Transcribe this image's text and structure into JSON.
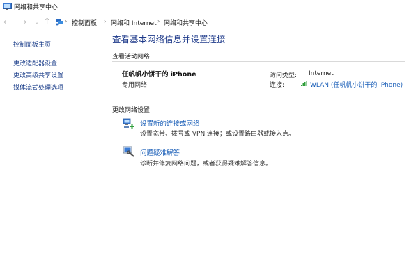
{
  "window": {
    "title": "网络和共享中心"
  },
  "nav": {
    "back_icon": "arrow-left-icon",
    "forward_icon": "arrow-right-icon",
    "history_icon": "chevron-down-icon",
    "up_icon": "arrow-up-icon"
  },
  "breadcrumb": [
    "控制面板",
    "网络和 Internet",
    "网络和共享中心"
  ],
  "sidebar": {
    "items": [
      {
        "label": "控制面板主页"
      },
      {
        "label": "更改适配器设置"
      },
      {
        "label": "更改高级共享设置"
      },
      {
        "label": "媒体流式处理选项"
      }
    ]
  },
  "main": {
    "title": "查看基本网络信息并设置连接",
    "active_section": "查看活动网络",
    "network": {
      "name": "任帆帆小饼干的 iPhone",
      "type": "专用网络",
      "access_label": "访问类型:",
      "access_value": "Internet",
      "connection_label": "连接:",
      "connection_value": "WLAN (任帆帆小饼干的 iPhone)"
    },
    "change_section": "更改网络设置",
    "tasks": [
      {
        "label": "设置新的连接或网络",
        "desc": "设置宽带、拨号或 VPN 连接；或设置路由器或接入点。",
        "icon": "new-connection-icon"
      },
      {
        "label": "问题疑难解答",
        "desc": "诊断并修复网络问题，或者获得疑难解答信息。",
        "icon": "troubleshoot-icon"
      }
    ]
  },
  "colors": {
    "link": "#1b5fb8",
    "title": "#1e3a8a",
    "sidebar_link": "#1b3e8a"
  }
}
